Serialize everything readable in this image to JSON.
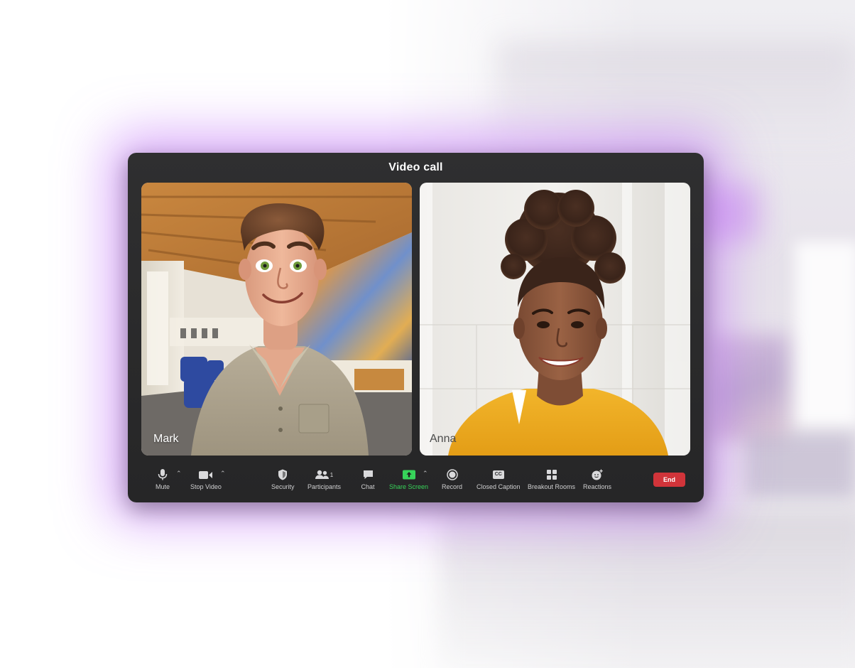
{
  "window": {
    "title": "Video call"
  },
  "participants": [
    {
      "name": "Mark"
    },
    {
      "name": "Anna"
    }
  ],
  "toolbar": {
    "mute": {
      "label": "Mute",
      "icon": "microphone-icon"
    },
    "stop_video": {
      "label": "Stop Video",
      "icon": "video-camera-icon"
    },
    "security": {
      "label": "Security",
      "icon": "shield-icon"
    },
    "participants": {
      "label": "Participants",
      "count": "1",
      "icon": "people-icon"
    },
    "chat": {
      "label": "Chat",
      "icon": "chat-bubble-icon"
    },
    "share_screen": {
      "label": "Share Screen",
      "icon": "share-screen-icon"
    },
    "record": {
      "label": "Record",
      "icon": "record-icon"
    },
    "closed_caption": {
      "label": "Closed Caption",
      "badge": "CC",
      "icon": "closed-caption-icon"
    },
    "breakout_rooms": {
      "label": "Breakout Rooms",
      "icon": "grid-icon"
    },
    "reactions": {
      "label": "Reactions",
      "icon": "smiley-add-icon"
    },
    "end": {
      "label": "End"
    }
  },
  "colors": {
    "accent_green": "#37d35a",
    "end_red": "#d1343a",
    "glow_purple": "#be6ef5",
    "window_bg": "#2b2b2c"
  }
}
